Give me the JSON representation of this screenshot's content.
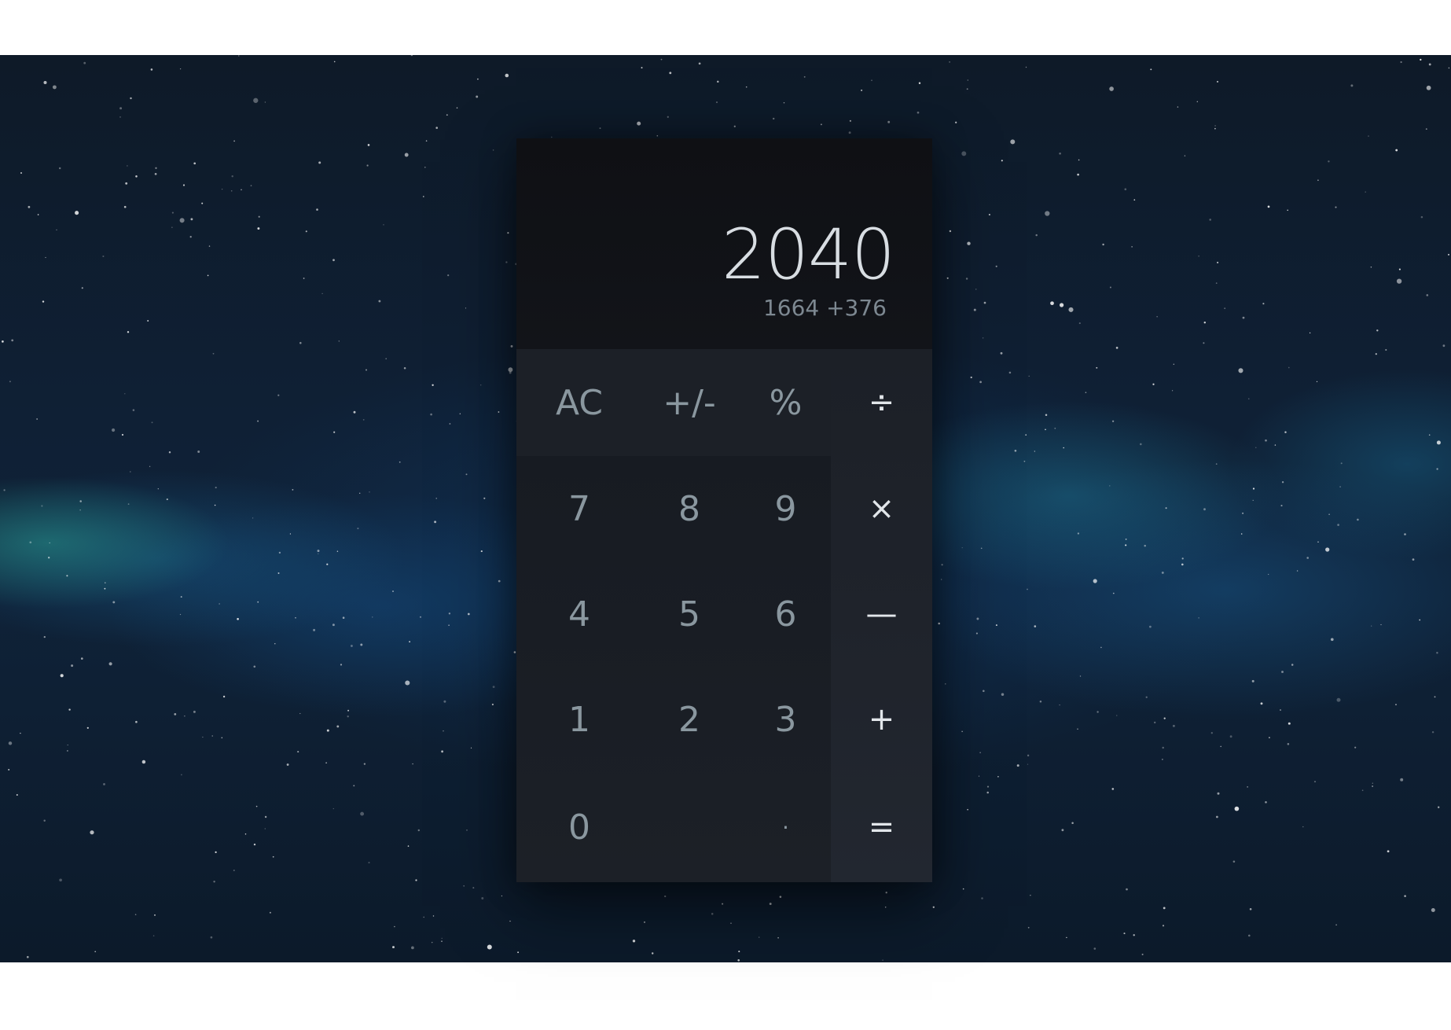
{
  "display": {
    "result": "2040",
    "expression": "1664 +376"
  },
  "keys": {
    "function": [
      "AC",
      "+/-",
      "%"
    ],
    "operators": [
      "÷",
      "×",
      "—",
      "+",
      "="
    ],
    "digits_row1": [
      "7",
      "8",
      "9"
    ],
    "digits_row2": [
      "4",
      "5",
      "6"
    ],
    "digits_row3": [
      "1",
      "2",
      "3"
    ],
    "digits_row4": [
      "0",
      "·"
    ]
  },
  "colors": {
    "background_top": "#0e1a28",
    "panel": "#181c23",
    "display": "#0f1014",
    "operator_column": "#1f232b",
    "key_text": "#8a979f",
    "operator_text": "#e2e6ea",
    "result_text": "#d8dde2"
  }
}
